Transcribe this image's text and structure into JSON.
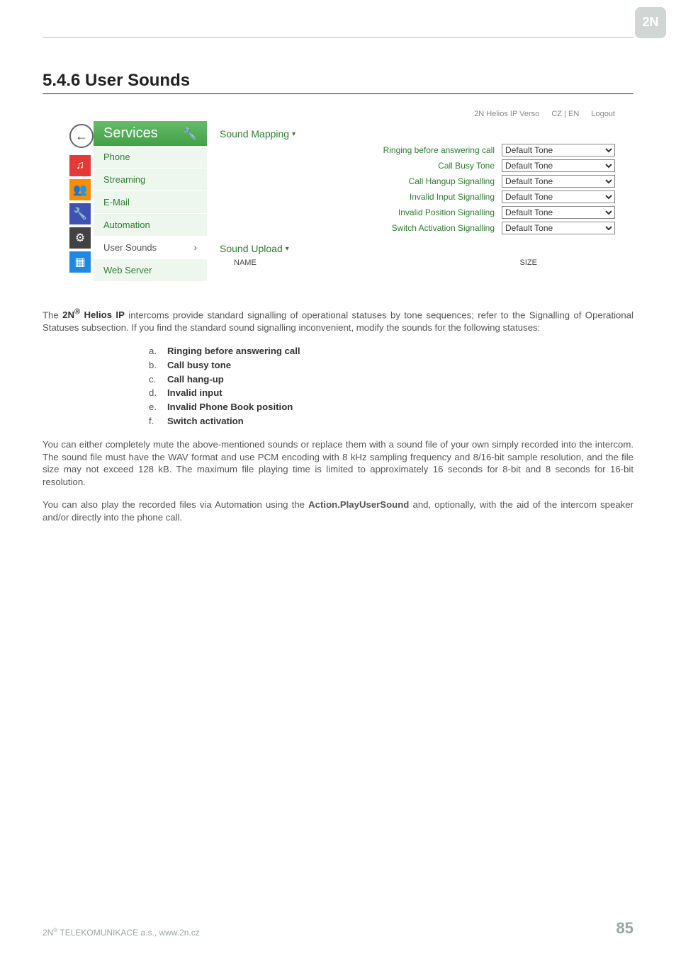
{
  "header": {
    "page_heading": "5.4.6 User Sounds"
  },
  "screenshot": {
    "device_label": "2N Helios IP Verso",
    "lang_label": "CZ | EN",
    "logout_label": "Logout",
    "sidebar": {
      "title": "Services",
      "items": [
        {
          "label": "Phone"
        },
        {
          "label": "Streaming"
        },
        {
          "label": "E-Mail"
        },
        {
          "label": "Automation"
        },
        {
          "label": "User Sounds",
          "active": true,
          "chevron": "›"
        },
        {
          "label": "Web Server"
        }
      ]
    },
    "sound_mapping": {
      "title": "Sound Mapping",
      "rows": [
        {
          "label": "Ringing before answering call",
          "value": "Default Tone"
        },
        {
          "label": "Call Busy Tone",
          "value": "Default Tone"
        },
        {
          "label": "Call Hangup Signalling",
          "value": "Default Tone"
        },
        {
          "label": "Invalid Input Signalling",
          "value": "Default Tone"
        },
        {
          "label": "Invalid Position Signalling",
          "value": "Default Tone"
        },
        {
          "label": "Switch Activation Signalling",
          "value": "Default Tone"
        }
      ]
    },
    "sound_upload": {
      "title": "Sound Upload",
      "col_name": "NAME",
      "col_size": "SIZE"
    }
  },
  "body": {
    "intro_prefix": "The ",
    "brand_bold": "2N",
    "brand_reg": "®",
    "brand_suffix_bold": " Helios IP",
    "intro_rest": " intercoms provide standard signalling of operational statuses by tone sequences; refer to the Signalling of Operational Statuses subsection. If you find the standard sound signalling inconvenient, modify the sounds for the following statuses:",
    "list": [
      {
        "marker": "a.",
        "text": "Ringing before answering call"
      },
      {
        "marker": "b.",
        "text": "Call busy tone"
      },
      {
        "marker": "c.",
        "text": "Call hang-up"
      },
      {
        "marker": "d.",
        "text": "Invalid input"
      },
      {
        "marker": "e.",
        "text": "Invalid Phone Book position"
      },
      {
        "marker": "f.",
        "text": "Switch activation"
      }
    ],
    "para2": "You can either completely mute the above-mentioned sounds or replace them with a sound file of your own simply recorded into the intercom. The sound file must have the WAV format and use PCM encoding with 8 kHz sampling frequency and 8/16-bit sample resolution, and the file size may not exceed 128 kB. The maximum file playing time is limited to approximately 16 seconds for 8-bit and 8 seconds for 16-bit resolution.",
    "para3_pre": "You can also play the recorded files via Automation using the ",
    "para3_bold": "Action.PlayUserSound",
    "para3_post": " and, optionally, with the aid of the intercom speaker and/or directly into the phone call."
  },
  "footer": {
    "company_pre": "2N",
    "company_sup": "®",
    "company_rest": " TELEKOMUNIKACE a.s., www.2n.cz",
    "page_number": "85"
  }
}
